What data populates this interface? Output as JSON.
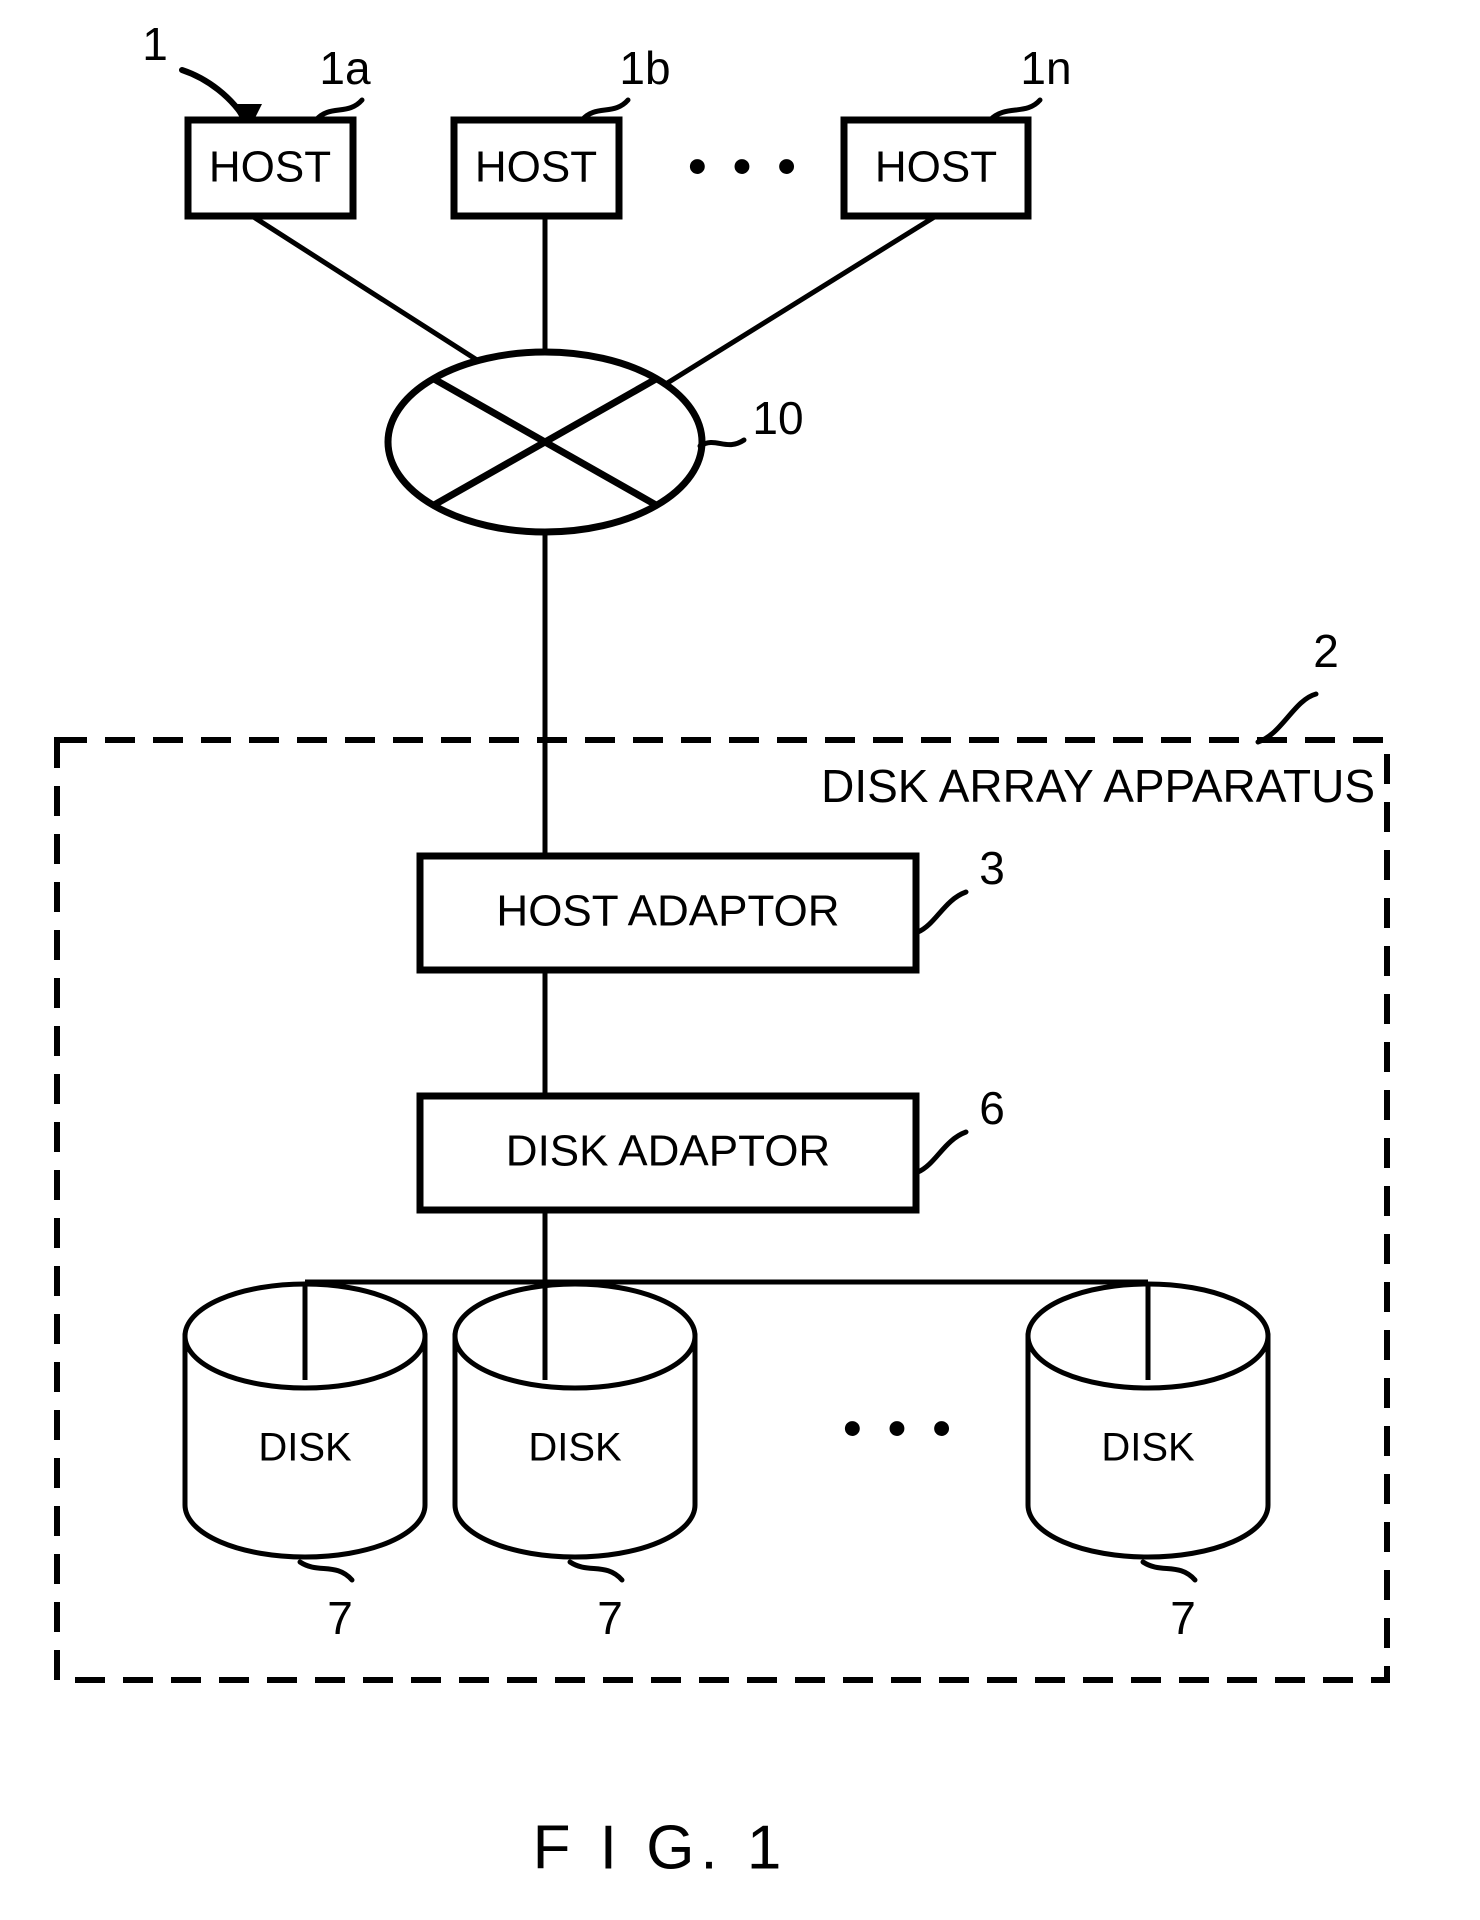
{
  "figure": {
    "caption": "F I G. 1",
    "title_label": "DISK ARRAY APPARATUS",
    "line_color": "#000000",
    "background_color": "#ffffff"
  },
  "hosts": {
    "group_ref": "1",
    "items": [
      {
        "label": "HOST",
        "ref": "1a"
      },
      {
        "label": "HOST",
        "ref": "1b"
      },
      {
        "label": "HOST",
        "ref": "1n"
      }
    ],
    "ellipsis": "• • •"
  },
  "network": {
    "label": "",
    "ref": "10",
    "shape": "ellipse-with-cross"
  },
  "apparatus": {
    "ref": "2",
    "label": "DISK ARRAY APPARATUS",
    "host_adaptor": {
      "label": "HOST ADAPTOR",
      "ref": "3"
    },
    "disk_adaptor": {
      "label": "DISK ADAPTOR",
      "ref": "6"
    },
    "disks": {
      "ellipsis": "• • •",
      "items": [
        {
          "label": "DISK",
          "ref": "7"
        },
        {
          "label": "DISK",
          "ref": "7"
        },
        {
          "label": "DISK",
          "ref": "7"
        }
      ]
    }
  }
}
